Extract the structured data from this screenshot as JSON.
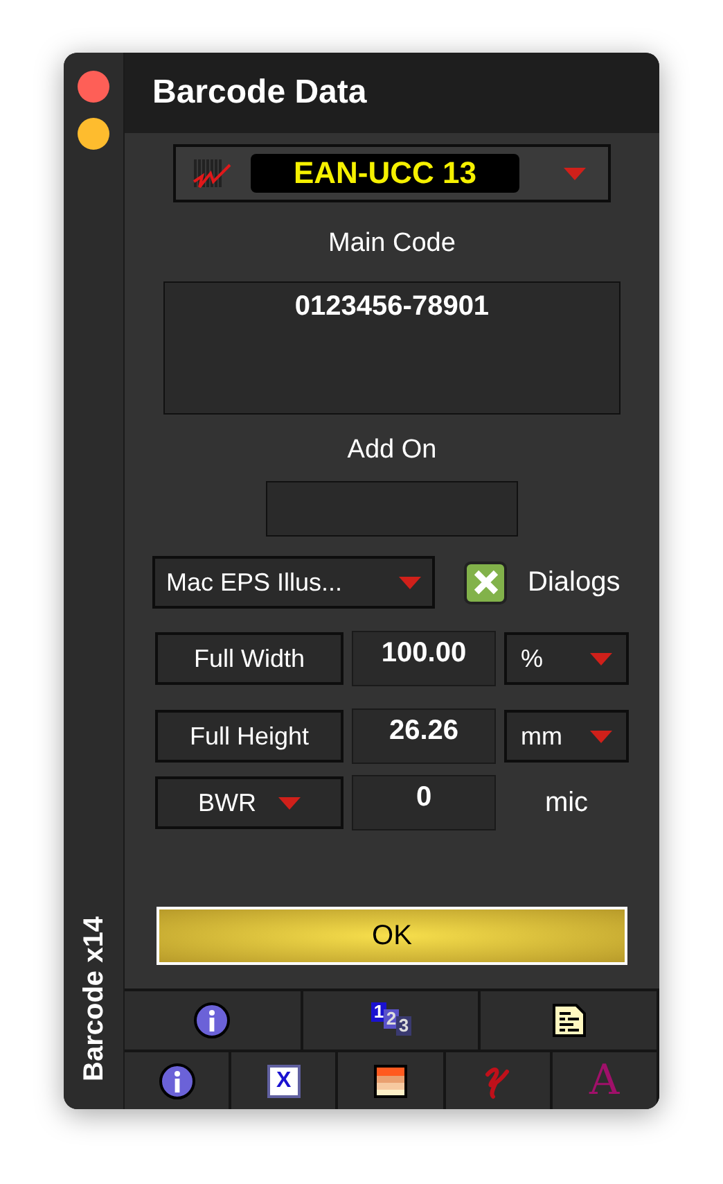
{
  "window": {
    "title": "Barcode Data",
    "side_label": "Barcode x14",
    "controls": [
      {
        "color": "#fe5f57"
      },
      {
        "color": "#febc2e"
      }
    ]
  },
  "symbology": {
    "value": "EAN-UCC 13"
  },
  "main_code": {
    "label": "Main Code",
    "value": "0123456-78901"
  },
  "add_on": {
    "label": "Add On"
  },
  "format": {
    "value": "Mac EPS Illus..."
  },
  "dialogs": {
    "label": "Dialogs",
    "checked": true
  },
  "rows": [
    {
      "kind": "button",
      "label": "Full Width",
      "value": "100.00",
      "unit": {
        "kind": "dropdown",
        "text": "%"
      }
    },
    {
      "kind": "button",
      "label": "Full Height",
      "value": "26.26",
      "unit": {
        "kind": "dropdown",
        "text": "mm"
      }
    },
    {
      "kind": "dropdown",
      "label": "BWR",
      "value": "0",
      "unit": {
        "kind": "text",
        "text": "mic"
      }
    }
  ],
  "ok_button": {
    "label": "OK"
  },
  "toolbar_top": [
    {
      "kind": "info"
    },
    {
      "kind": "numbers",
      "glyph": "123"
    },
    {
      "kind": "document"
    }
  ],
  "toolbar_bottom": [
    {
      "kind": "info"
    },
    {
      "kind": "x-box",
      "glyph": "X"
    },
    {
      "kind": "swatch"
    },
    {
      "kind": "squiggle"
    },
    {
      "kind": "letter",
      "glyph": "A"
    }
  ]
}
